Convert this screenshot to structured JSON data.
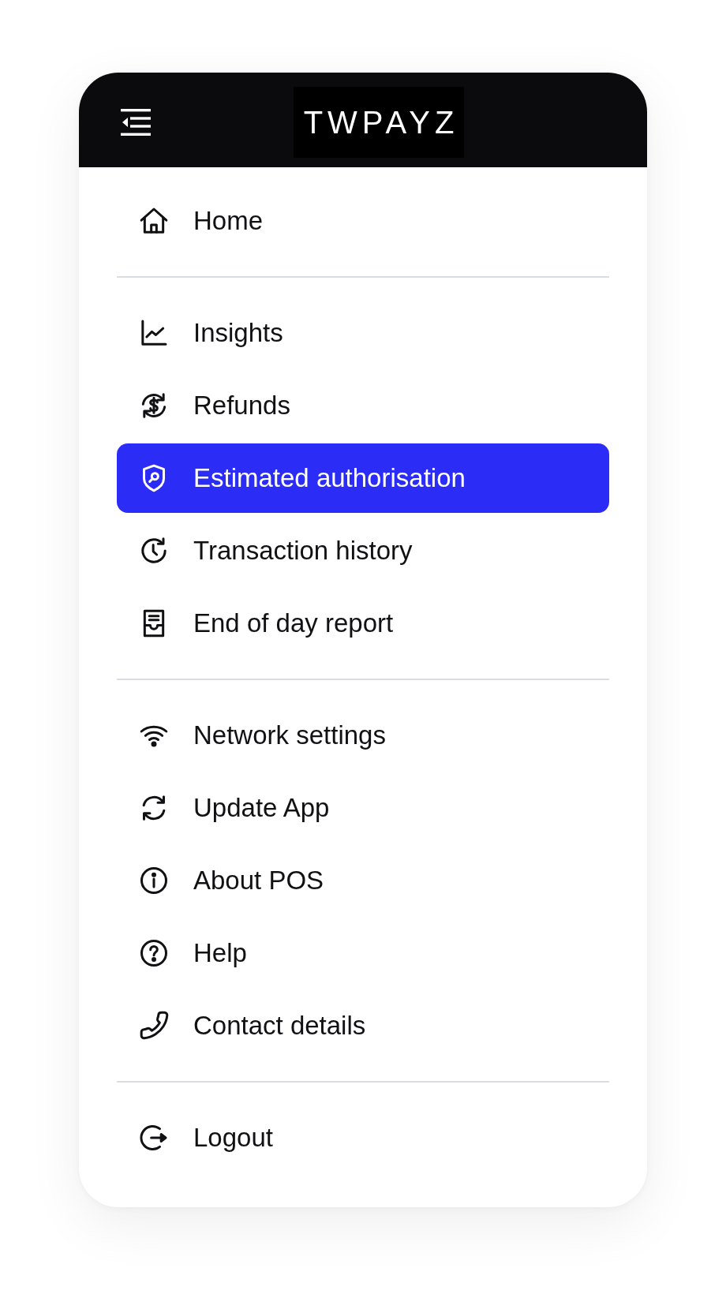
{
  "header": {
    "logo": "TWPAYZ"
  },
  "menu": {
    "sections": [
      {
        "items": [
          {
            "label": "Home",
            "selected": false
          }
        ]
      },
      {
        "items": [
          {
            "label": "Insights",
            "selected": false
          },
          {
            "label": "Refunds",
            "selected": false
          },
          {
            "label": "Estimated authorisation",
            "selected": true
          },
          {
            "label": "Transaction history",
            "selected": false
          },
          {
            "label": "End of day report",
            "selected": false
          }
        ]
      },
      {
        "items": [
          {
            "label": "Network settings",
            "selected": false
          },
          {
            "label": "Update App",
            "selected": false
          },
          {
            "label": "About POS",
            "selected": false
          },
          {
            "label": "Help",
            "selected": false
          },
          {
            "label": "Contact details",
            "selected": false
          }
        ]
      },
      {
        "items": [
          {
            "label": "Logout",
            "selected": false
          }
        ]
      }
    ]
  }
}
